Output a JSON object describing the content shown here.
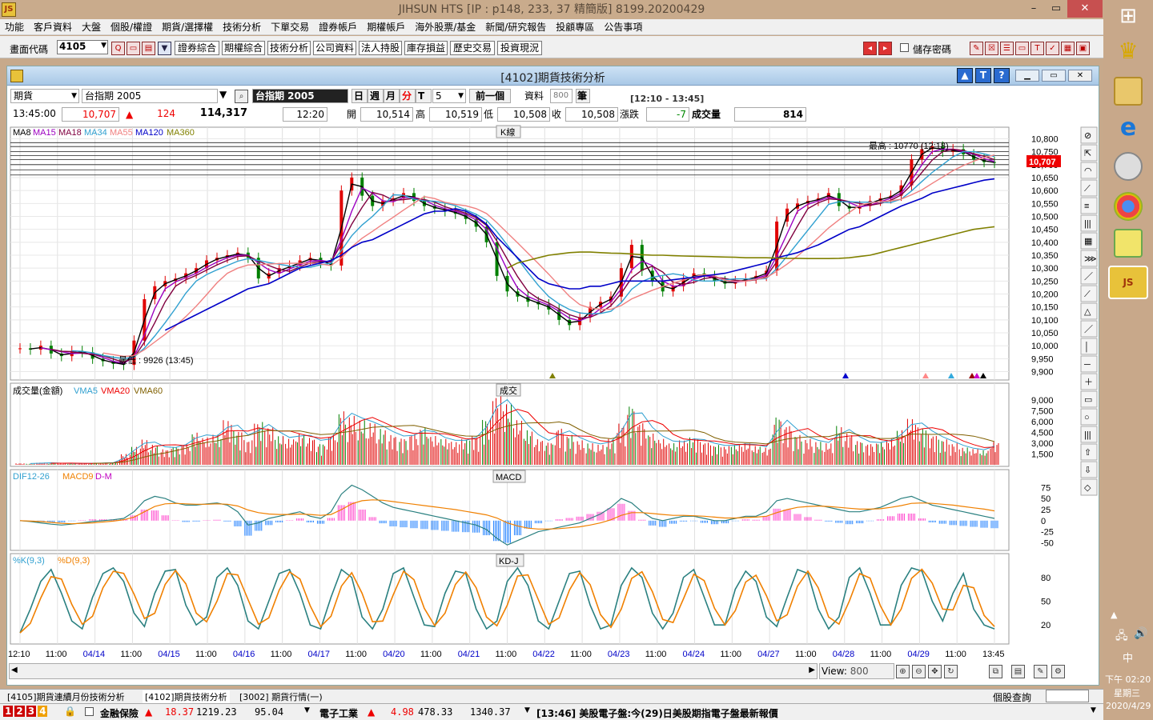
{
  "window": {
    "title": "JIHSUN HTS      [IP : p148, 233, 37 精簡版] 8199.20200429",
    "min": "–",
    "restore": "▭",
    "close": "✕"
  },
  "menu": [
    "功能",
    "客戶資料",
    "大盤",
    "個股/權證",
    "期貨/選擇權",
    "技術分析",
    "下單交易",
    "證券帳戶",
    "期權帳戶",
    "海外股票/基金",
    "新聞/研究報告",
    "投顧專區",
    "公告事項"
  ],
  "toolbar": {
    "code_label": "畫面代碼",
    "code_value": "4105",
    "buttons": [
      "證券綜合",
      "期權綜合",
      "技術分析",
      "公司資料",
      "法人持股",
      "庫存損益",
      "歷史交易",
      "投資現況"
    ],
    "save_pwd": "儲存密碼"
  },
  "panel": {
    "title": "[4102]期貨技術分析",
    "kind": "期貨",
    "contract": "台指期 2005",
    "contract_dark": "台指期 2005",
    "periods": [
      "日",
      "週",
      "月",
      "分",
      "T"
    ],
    "minute": "5",
    "prev": "前一個",
    "data_label": "資料",
    "data_count": "800",
    "unit": "筆",
    "time_range": "[12:10 - 13:45]"
  },
  "quote": {
    "time": "13:45:00",
    "price": "10,707",
    "change": "124",
    "volume_total": "114,317",
    "qtime": "12:20",
    "open_label": "開",
    "open": "10,514",
    "high_label": "高",
    "high": "10,519",
    "low_label": "低",
    "low": "10,508",
    "close_label": "收",
    "close": "10,508",
    "chg_label": "漲跌",
    "chg": "-7",
    "vol_label": "成交量",
    "vol": "814"
  },
  "chart_data": {
    "type": "line",
    "kline": {
      "label": "K線",
      "ma_labels": [
        "MA8",
        "MA15",
        "MA18",
        "MA34",
        "MA55",
        "MA120",
        "MA360"
      ],
      "high_note": "最高 : 10770 (12:18)",
      "low_note": "最低 : 9926 (13:45)",
      "last_price": "10,707",
      "y_ticks": [
        "10,800",
        "10,750",
        "10,700",
        "10,650",
        "10,600",
        "10,550",
        "10,500",
        "10,450",
        "10,400",
        "10,350",
        "10,300",
        "10,250",
        "10,200",
        "10,150",
        "10,100",
        "10,050",
        "10,000",
        "9,950",
        "9,900"
      ],
      "ylim": [
        9880,
        10820
      ],
      "close": [
        9990,
        9985,
        10000,
        9970,
        9960,
        9980,
        9975,
        9950,
        9940,
        9930,
        9926,
        10020,
        10180,
        10230,
        10250,
        10260,
        10280,
        10300,
        10330,
        10340,
        10350,
        10360,
        10340,
        10260,
        10280,
        10300,
        10310,
        10330,
        10340,
        10320,
        10310,
        10600,
        10650,
        10580,
        10540,
        10560,
        10570,
        10590,
        10560,
        10540,
        10530,
        10520,
        10510,
        10490,
        10460,
        10400,
        10270,
        10210,
        10190,
        10170,
        10160,
        10140,
        10100,
        10080,
        10110,
        10150,
        10170,
        10190,
        10300,
        10390,
        10290,
        10250,
        10210,
        10230,
        10260,
        10280,
        10270,
        10250,
        10240,
        10250,
        10260,
        10270,
        10290,
        10480,
        10530,
        10550,
        10560,
        10570,
        10590,
        10540,
        10530,
        10540,
        10560,
        10570,
        10580,
        10620,
        10720,
        10760,
        10770,
        10750,
        10760,
        10740,
        10720,
        10710,
        10707
      ],
      "ma120": [
        null,
        null,
        null,
        null,
        null,
        null,
        null,
        null,
        null,
        null,
        null,
        null,
        null,
        null,
        10060,
        10080,
        10100,
        10120,
        10140,
        10160,
        10180,
        10200,
        10220,
        10230,
        10240,
        10260,
        10280,
        10300,
        10310,
        10320,
        10330,
        10350,
        10380,
        10400,
        10410,
        10430,
        10450,
        10470,
        10490,
        10510,
        10520,
        10520,
        10530,
        10520,
        10500,
        10470,
        10420,
        10380,
        10340,
        10300,
        10260,
        10240,
        10230,
        10220,
        10220,
        10230,
        10230,
        10240,
        10250,
        10250,
        10250,
        10250,
        10250,
        10255,
        10260,
        10265,
        10270,
        10275,
        10280,
        10290,
        10300,
        10310,
        10320,
        10340,
        10350,
        10360,
        10375,
        10390,
        10410,
        10430,
        10450,
        10460,
        10480,
        10500,
        10520,
        10540,
        10555,
        10570,
        10590,
        10600,
        10610,
        10620,
        10630,
        10640,
        10645
      ],
      "ma360": [
        null,
        null,
        null,
        null,
        null,
        null,
        null,
        null,
        null,
        null,
        null,
        null,
        null,
        null,
        null,
        null,
        null,
        null,
        null,
        null,
        null,
        null,
        null,
        null,
        null,
        null,
        null,
        null,
        null,
        null,
        null,
        null,
        null,
        null,
        null,
        null,
        null,
        null,
        null,
        null,
        null,
        null,
        null,
        null,
        null,
        null,
        null,
        10300,
        10320,
        10330,
        10340,
        10350,
        10355,
        10360,
        10362,
        10362,
        10360,
        10358,
        10357,
        10355,
        10352,
        10350,
        10350,
        10348,
        10347,
        10346,
        10345,
        10344,
        10343,
        10342,
        10340,
        10340,
        10340,
        10339,
        10338,
        10338,
        10337,
        10337,
        10337,
        10338,
        10340,
        10345,
        10350,
        10360,
        10370,
        10380,
        10390,
        10400,
        10410,
        10420,
        10430,
        10440,
        10450,
        10455,
        10460
      ]
    },
    "volume": {
      "label": "成交",
      "legend": [
        "成交量(金額)",
        "VMA5",
        "VMA20",
        "VMA60"
      ],
      "y_ticks": [
        "9,000",
        "7,500",
        "6,000",
        "4,500",
        "3,000",
        "1,500"
      ],
      "ylim": [
        0,
        10000
      ],
      "values": [
        200,
        150,
        300,
        250,
        200,
        180,
        220,
        200,
        300,
        280,
        1500,
        2500,
        3500,
        2800,
        2200,
        2600,
        3000,
        4500,
        3800,
        4200,
        6200,
        4800,
        3500,
        6000,
        5200,
        4000,
        3600,
        4400,
        3800,
        3000,
        4200,
        7500,
        6800,
        6200,
        5800,
        5000,
        4200,
        3800,
        4400,
        5200,
        4000,
        3600,
        3200,
        3600,
        4000,
        6500,
        9600,
        8500,
        6200,
        4800,
        3600,
        3200,
        5200,
        4200,
        3400,
        3000,
        2800,
        3600,
        5800,
        8400,
        6000,
        4400,
        3600,
        3000,
        3400,
        3800,
        3200,
        2800,
        2600,
        2800,
        3000,
        2600,
        2400,
        6800,
        5600,
        4200,
        3600,
        3200,
        3000,
        5400,
        4400,
        3400,
        3000,
        3200,
        3600,
        4800,
        6400,
        5200,
        4200,
        3600,
        3000,
        2400,
        2200,
        2000,
        3200
      ]
    },
    "macd": {
      "label": "MACD",
      "legend": [
        "DIF12-26",
        "MACD9",
        "D-M"
      ],
      "y_ticks": [
        "75",
        "50",
        "25",
        "0",
        "-25",
        "-50"
      ],
      "ylim": [
        -60,
        90
      ],
      "dif": [
        0,
        -2,
        -5,
        -8,
        -10,
        -8,
        -5,
        -2,
        0,
        2,
        5,
        20,
        45,
        55,
        50,
        40,
        35,
        35,
        38,
        40,
        35,
        20,
        -10,
        -5,
        5,
        10,
        15,
        20,
        10,
        5,
        20,
        60,
        80,
        70,
        55,
        40,
        30,
        25,
        20,
        15,
        10,
        5,
        0,
        -5,
        -10,
        -20,
        -40,
        -55,
        -45,
        -35,
        -25,
        -20,
        -15,
        -10,
        -5,
        5,
        15,
        30,
        50,
        40,
        20,
        5,
        0,
        5,
        10,
        10,
        5,
        0,
        0,
        5,
        10,
        10,
        20,
        45,
        50,
        45,
        40,
        35,
        30,
        25,
        20,
        20,
        25,
        30,
        40,
        50,
        55,
        45,
        35,
        30,
        25,
        20,
        15,
        10,
        5
      ],
      "dea": [
        0,
        -1,
        -2,
        -4,
        -6,
        -7,
        -6,
        -5,
        -3,
        -1,
        2,
        8,
        20,
        32,
        38,
        39,
        38,
        37,
        37,
        38,
        37,
        33,
        24,
        18,
        15,
        14,
        14,
        15,
        14,
        12,
        14,
        25,
        38,
        45,
        47,
        46,
        43,
        40,
        37,
        34,
        31,
        28,
        25,
        21,
        17,
        13,
        6,
        -5,
        -12,
        -17,
        -19,
        -19,
        -18,
        -16,
        -14,
        -10,
        -5,
        2,
        12,
        18,
        18,
        16,
        14,
        12,
        12,
        11,
        10,
        8,
        6,
        6,
        7,
        8,
        10,
        18,
        25,
        30,
        32,
        33,
        32,
        30,
        28,
        26,
        26,
        27,
        30,
        34,
        39,
        40,
        39,
        37,
        35,
        32,
        29,
        26,
        22
      ]
    },
    "kd": {
      "label": "KD-J",
      "legend": [
        "%K(9,3)",
        "%D(9,3)"
      ],
      "y_ticks": [
        "80",
        "50",
        "20"
      ],
      "ylim": [
        0,
        100
      ],
      "k": [
        10,
        40,
        75,
        90,
        60,
        25,
        15,
        55,
        85,
        92,
        75,
        35,
        18,
        60,
        88,
        90,
        45,
        20,
        30,
        80,
        92,
        70,
        25,
        15,
        50,
        85,
        90,
        60,
        20,
        15,
        55,
        90,
        80,
        30,
        15,
        40,
        85,
        92,
        55,
        20,
        18,
        60,
        88,
        85,
        40,
        15,
        25,
        75,
        92,
        70,
        25,
        15,
        50,
        85,
        88,
        45,
        15,
        20,
        70,
        92,
        80,
        35,
        15,
        35,
        80,
        90,
        55,
        20,
        20,
        65,
        88,
        75,
        30,
        18,
        55,
        90,
        85,
        40,
        15,
        30,
        80,
        92,
        60,
        20,
        20,
        70,
        92,
        88,
        50,
        25,
        60,
        85,
        40,
        20,
        15
      ]
    }
  },
  "xaxis": [
    "12:10",
    "11:00",
    "04/14",
    "11:00",
    "04/15",
    "11:00",
    "04/16",
    "11:00",
    "04/17",
    "11:00",
    "04/20",
    "11:00",
    "04/21",
    "11:00",
    "04/22",
    "11:00",
    "04/23",
    "11:00",
    "04/24",
    "11:00",
    "04/27",
    "11:00",
    "04/28",
    "11:00",
    "04/29",
    "11:00",
    "13:45"
  ],
  "view": {
    "label": "View:",
    "value": "800"
  },
  "tabs": [
    "[4105]期貨連續月份技術分析",
    "[4102]期貨技術分析",
    "[3002] 期貨行情(一)"
  ],
  "tabs_right": {
    "label": "個股查詢"
  },
  "status": {
    "s1_name": "金融保險",
    "s1_chg": "18.37",
    "s1_idx": "1219.23",
    "s1_vol": "95.04",
    "s2_name": "電子工業",
    "s2_chg": "4.98",
    "s2_idx": "478.33",
    "s2_vol": "1340.37",
    "news": "[13:46] 美股電子盤:今(29)日美股期指電子盤最新報價"
  },
  "clock": {
    "time": "下午 02:20",
    "day": "星期三",
    "date": "2020/4/29",
    "ime": "中"
  },
  "colors": {
    "up": "#e00000",
    "down": "#008000",
    "ma8": "#000000",
    "ma15": "#9c00c0",
    "ma18": "#800040",
    "ma34": "#30a0d0",
    "ma55": "#f08080",
    "ma120": "#0000c8",
    "ma360": "#808000",
    "k": "#2a8080",
    "d": "#f08000",
    "bar_pos": "#ff44cc",
    "bar_neg": "#2080ff"
  }
}
